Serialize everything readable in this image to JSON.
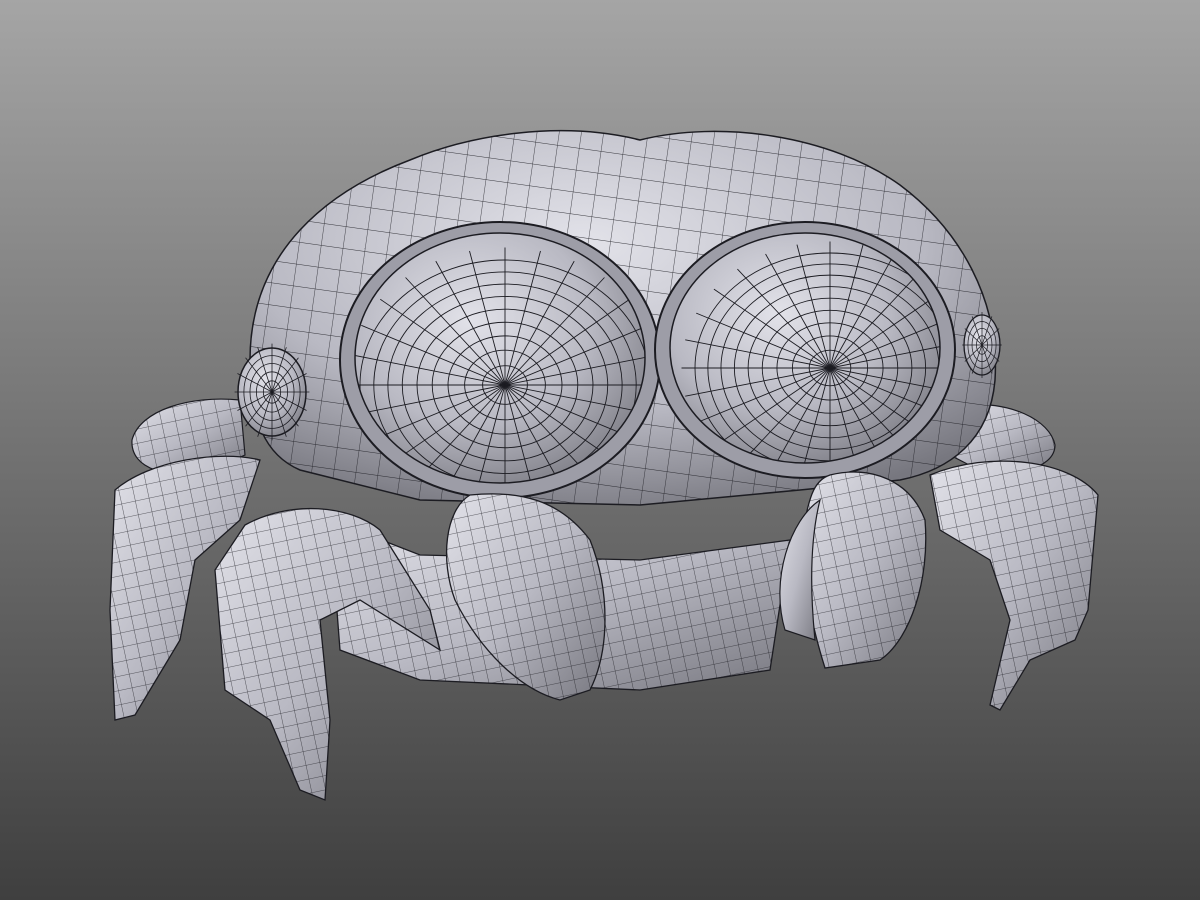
{
  "scene": {
    "subject": "crab-wireframe-model",
    "colors": {
      "background_top": "#a5a5a5",
      "background_bottom": "#3f3f3f",
      "mesh_fill_light": "#e2e2e9",
      "mesh_fill_mid": "#b9b9c3",
      "mesh_fill_dark": "#77777f",
      "wire": "#1c1c22"
    }
  }
}
